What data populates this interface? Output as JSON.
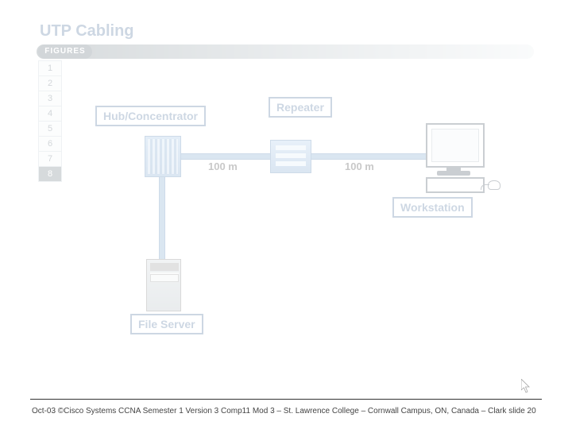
{
  "title": "UTP Cabling",
  "figures_label": "FIGURES",
  "figure_tabs": [
    "1",
    "2",
    "3",
    "4",
    "5",
    "6",
    "7",
    "8"
  ],
  "active_tab": "8",
  "labels": {
    "hub": "Hub/Concentrator",
    "repeater": "Repeater",
    "workstation": "Workstation",
    "file_server": "File Server"
  },
  "distances": {
    "hub_to_repeater": "100 m",
    "repeater_to_workstation": "100 m"
  },
  "footer": "Oct-03 ©Cisco Systems CCNA Semester 1 Version 3 Comp11 Mod 3 – St. Lawrence College – Cornwall Campus, ON, Canada – Clark slide  20"
}
